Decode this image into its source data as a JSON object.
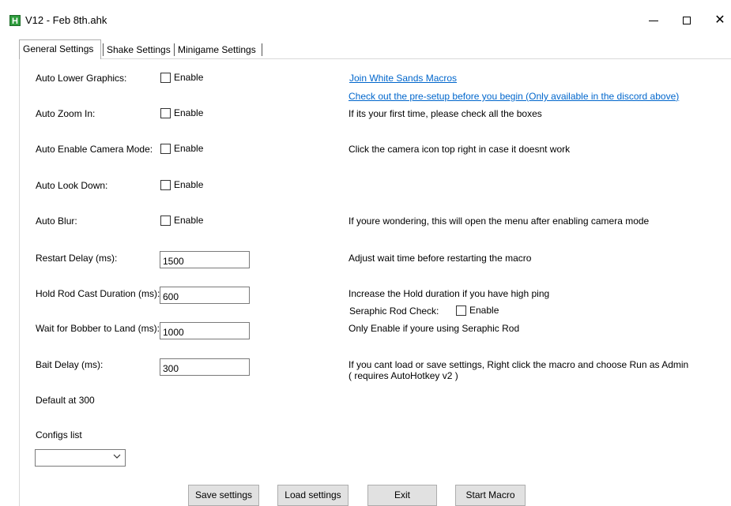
{
  "window": {
    "title": "V12 - Feb 8th.ahk",
    "icon_letter": "H",
    "controls": {
      "minimize": "—",
      "maximize": "☐",
      "close": "✕"
    }
  },
  "tabs": [
    {
      "label": "General Settings",
      "active": true
    },
    {
      "label": "Shake Settings",
      "active": false
    },
    {
      "label": "Minigame Settings",
      "active": false
    }
  ],
  "settings": {
    "auto_lower_graphics": {
      "label": "Auto Lower Graphics:",
      "checkbox": "Enable",
      "checked": false
    },
    "auto_zoom_in": {
      "label": "Auto Zoom In:",
      "checkbox": "Enable",
      "checked": false
    },
    "auto_camera_mode": {
      "label": "Auto Enable Camera Mode:",
      "checkbox": "Enable",
      "checked": false
    },
    "auto_look_down": {
      "label": "Auto Look Down:",
      "checkbox": "Enable",
      "checked": false
    },
    "auto_blur": {
      "label": "Auto Blur:",
      "checkbox": "Enable",
      "checked": false
    },
    "restart_delay": {
      "label": "Restart Delay (ms):",
      "value": "1500"
    },
    "hold_rod_cast": {
      "label": "Hold Rod Cast Duration (ms):",
      "value": "600"
    },
    "wait_bobber": {
      "label": "Wait for Bobber to Land (ms):",
      "value": "1000"
    },
    "bait_delay": {
      "label": "Bait Delay (ms):",
      "value": "300"
    },
    "default_note": "Default at 300",
    "configs_label": "Configs list",
    "configs_selected": ""
  },
  "info": {
    "join_link": "Join White Sands Macros",
    "pre_setup_link": "Check out the pre-setup before you begin (Only available in the discord above)",
    "first_time": "If its your first time, please check all the boxes",
    "camera_hint": "Click the camera icon top right in case it doesnt work",
    "blur_hint": "If youre wondering, this will open the menu after enabling camera mode",
    "restart_hint": "Adjust wait time before restarting the macro",
    "hold_hint": "Increase the Hold duration if you have high ping",
    "seraphic_label": "Seraphic Rod Check:",
    "seraphic_checkbox": "Enable",
    "seraphic_hint": "Only Enable if youre using Seraphic Rod",
    "admin_hint_1": "If you cant load or save settings, Right click the macro and choose Run as Admin",
    "admin_hint_2": "( requires AutoHotkey v2 )"
  },
  "buttons": {
    "save": "Save settings",
    "load": "Load settings",
    "exit": "Exit",
    "start": "Start Macro"
  }
}
